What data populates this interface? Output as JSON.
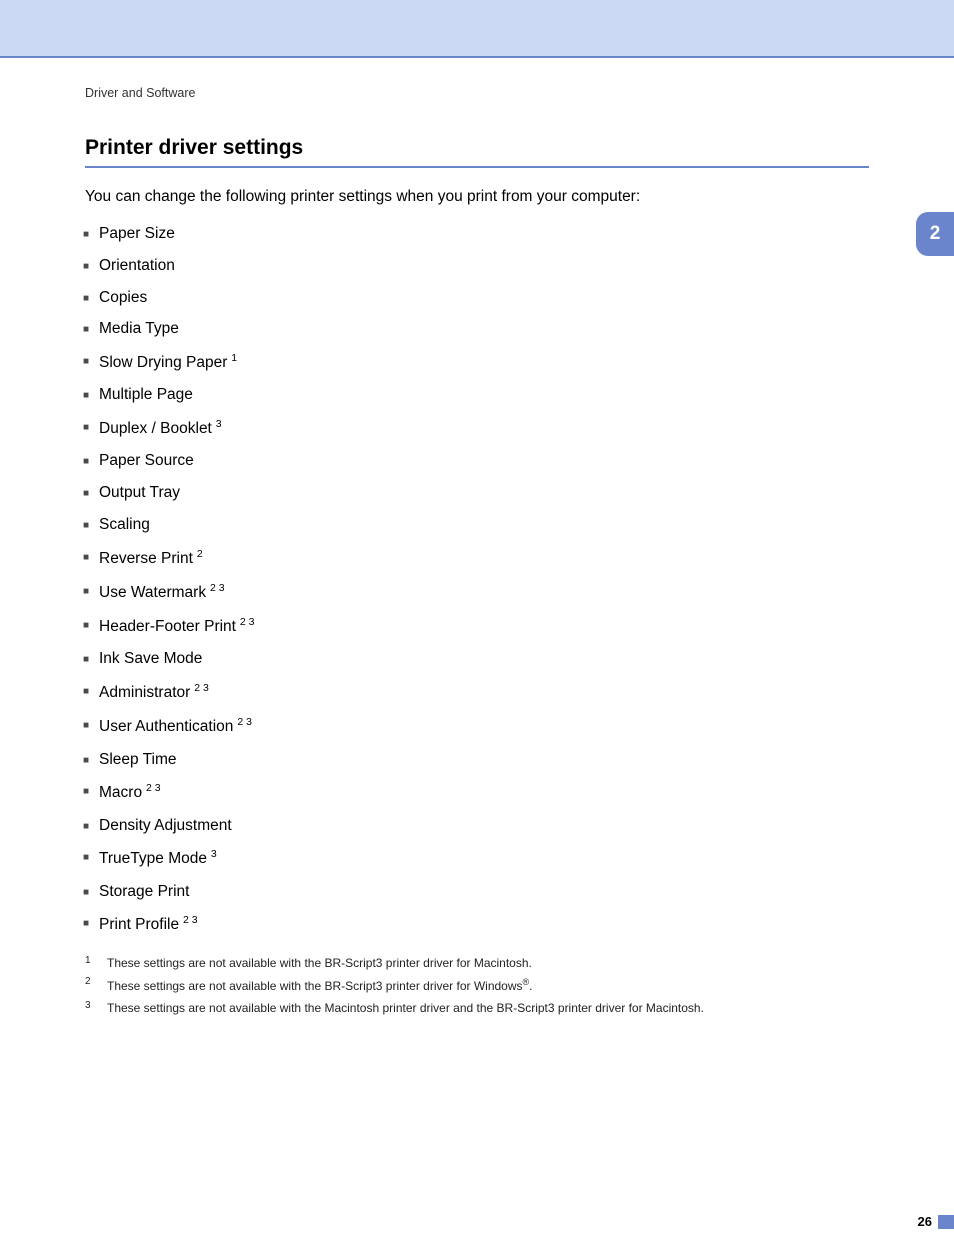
{
  "breadcrumb": "Driver and Software",
  "heading": "Printer driver settings",
  "intro": "You can change the following printer settings when you print from your computer:",
  "side_tab": "2",
  "page_number": "26",
  "items": [
    {
      "label": "Paper Size",
      "refs": []
    },
    {
      "label": "Orientation",
      "refs": []
    },
    {
      "label": "Copies",
      "refs": []
    },
    {
      "label": "Media Type",
      "refs": []
    },
    {
      "label": "Slow Drying Paper",
      "refs": [
        "1"
      ]
    },
    {
      "label": "Multiple Page",
      "refs": []
    },
    {
      "label": "Duplex / Booklet",
      "refs": [
        "3"
      ]
    },
    {
      "label": "Paper Source",
      "refs": []
    },
    {
      "label": "Output Tray",
      "refs": []
    },
    {
      "label": "Scaling",
      "refs": []
    },
    {
      "label": "Reverse Print",
      "refs": [
        "2"
      ]
    },
    {
      "label": "Use Watermark",
      "refs": [
        "2",
        "3"
      ]
    },
    {
      "label": "Header-Footer Print",
      "refs": [
        "2",
        "3"
      ]
    },
    {
      "label": "Ink Save Mode",
      "refs": []
    },
    {
      "label": "Administrator",
      "refs": [
        "2",
        "3"
      ]
    },
    {
      "label": "User Authentication",
      "refs": [
        "2",
        "3"
      ]
    },
    {
      "label": "Sleep Time",
      "refs": []
    },
    {
      "label": "Macro",
      "refs": [
        "2",
        "3"
      ]
    },
    {
      "label": "Density Adjustment",
      "refs": []
    },
    {
      "label": "TrueType Mode",
      "refs": [
        "3"
      ]
    },
    {
      "label": "Storage Print",
      "refs": []
    },
    {
      "label": "Print Profile",
      "refs": [
        "2",
        "3"
      ]
    }
  ],
  "footnotes": [
    {
      "num": "1",
      "text": "These settings are not available with the BR-Script3 printer driver for Macintosh."
    },
    {
      "num": "2",
      "text": "These settings are not available with the BR-Script3 printer driver for Windows",
      "suffix_reg": true,
      "tail": "."
    },
    {
      "num": "3",
      "text": "These settings are not available with the Macintosh printer driver and the BR-Script3 printer driver for Macintosh."
    }
  ]
}
